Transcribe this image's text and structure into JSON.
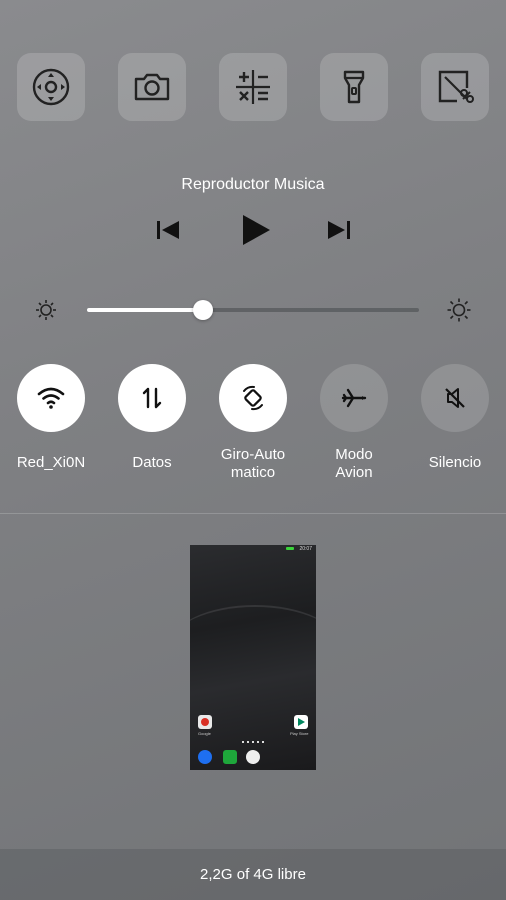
{
  "shortcuts": [
    {
      "id": "remote",
      "icon": "remote-control-icon"
    },
    {
      "id": "camera",
      "icon": "camera-icon"
    },
    {
      "id": "calculator",
      "icon": "calculator-icon"
    },
    {
      "id": "flashlight",
      "icon": "flashlight-icon"
    },
    {
      "id": "screenshot",
      "icon": "screenshot-cut-icon"
    }
  ],
  "music": {
    "title": "Reproductor Musica",
    "prev_icon": "skip-previous-icon",
    "play_icon": "play-icon",
    "next_icon": "skip-next-icon"
  },
  "brightness": {
    "level_fraction": 0.35,
    "low_icon": "brightness-low-icon",
    "high_icon": "brightness-high-icon"
  },
  "toggles": [
    {
      "label": "Red_Xi0N",
      "icon": "wifi-icon",
      "state": "on"
    },
    {
      "label": "Datos",
      "icon": "mobile-data-icon",
      "state": "on"
    },
    {
      "label": "Giro-Auto\nmatico",
      "icon": "auto-rotate-icon",
      "state": "on"
    },
    {
      "label": "Modo\nAvion",
      "icon": "airplane-icon",
      "state": "off"
    },
    {
      "label": "Silencio",
      "icon": "mute-icon",
      "state": "off"
    }
  ],
  "recent_app": {
    "status_time": "20:07",
    "app_labels": [
      "Google",
      "Play Store"
    ]
  },
  "footer": {
    "memory_text": "2,2G of 4G libre"
  },
  "colors": {
    "on_toggle_bg": "#ffffff",
    "icon_dark": "#222222"
  }
}
